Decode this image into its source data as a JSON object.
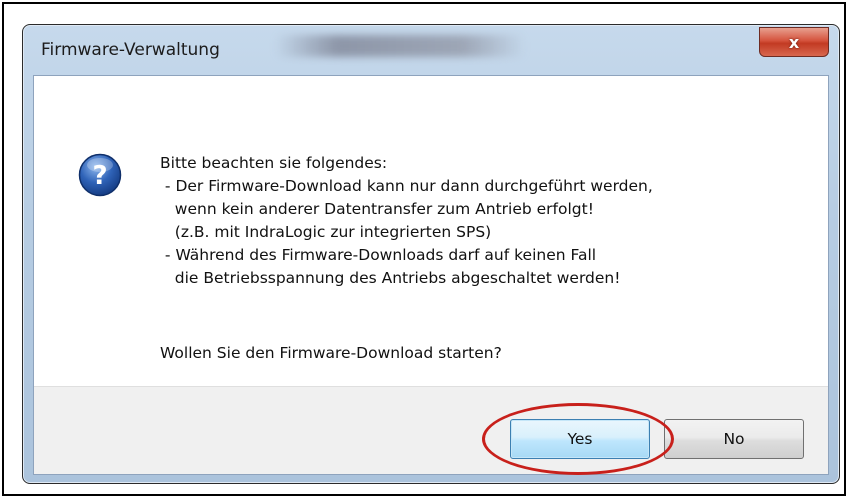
{
  "dialog": {
    "title": "Firmware-Verwaltung",
    "close_label": "x",
    "icon": "question-icon",
    "message_lines": [
      "Bitte beachten sie folgendes:",
      " - Der Firmware-Download kann nur dann durchgeführt werden,",
      "   wenn kein anderer Datentransfer zum Antrieb erfolgt!",
      "   (z.B. mit IndraLogic zur integrierten SPS)",
      " - Während des Firmware-Downloads darf auf keinen Fall",
      "   die Betriebsspannung des Antriebs abgeschaltet werden!"
    ],
    "question": "Wollen Sie den Firmware-Download starten?",
    "buttons": {
      "yes": "Yes",
      "no": "No"
    }
  },
  "colors": {
    "annotation_ellipse": "#c8201b",
    "icon_blue": "#2f63b8",
    "close_button": "#c94a33"
  }
}
